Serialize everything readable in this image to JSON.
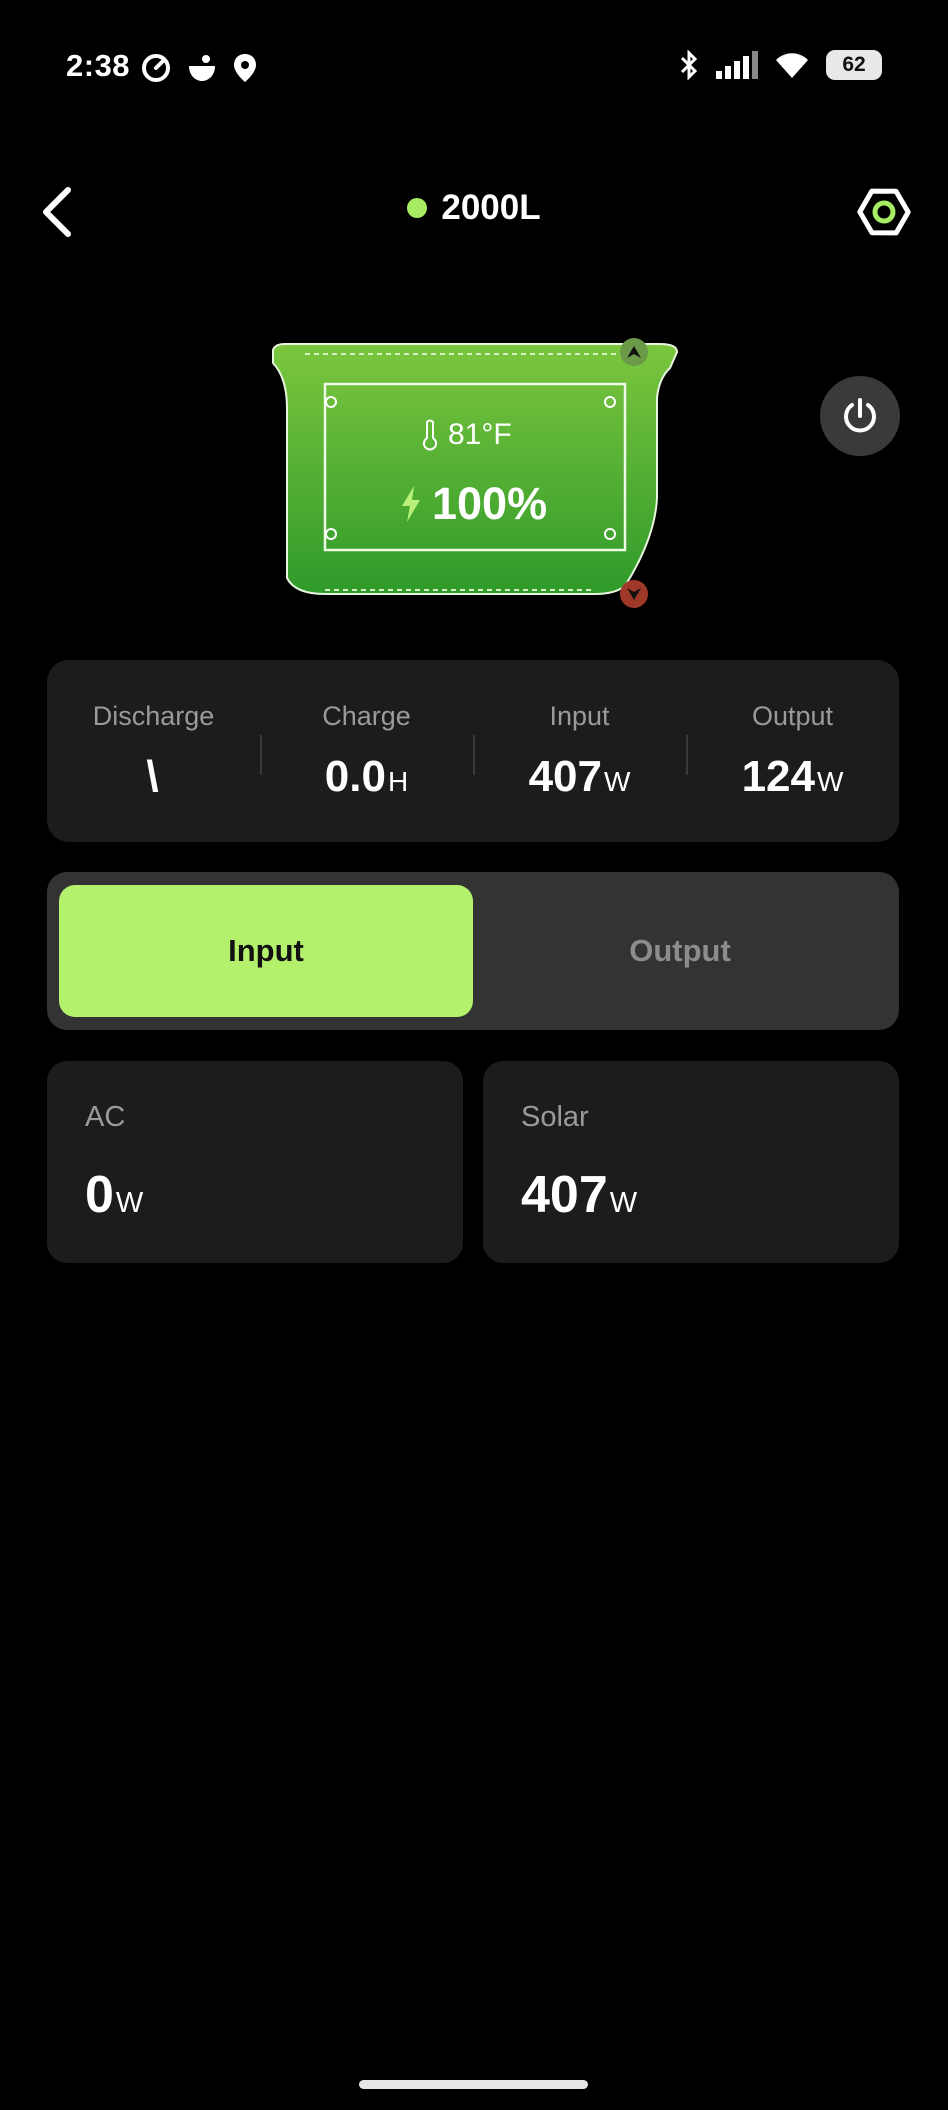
{
  "status_bar": {
    "time": "2:38",
    "battery": "62",
    "icons_left": [
      "sync-icon",
      "bowl-icon",
      "location-icon"
    ],
    "icons_right": [
      "bluetooth-icon",
      "signal-icon",
      "wifi-icon",
      "battery-icon"
    ]
  },
  "header": {
    "title": "2000L",
    "online_color": "#a7ec62"
  },
  "device": {
    "temperature": "81°F",
    "battery_level": "100%"
  },
  "stats": [
    {
      "label": "Discharge",
      "value": "\\",
      "unit": ""
    },
    {
      "label": "Charge",
      "value": "0.0",
      "unit": "H"
    },
    {
      "label": "Input",
      "value": "407",
      "unit": "W"
    },
    {
      "label": "Output",
      "value": "124",
      "unit": "W"
    }
  ],
  "tabs": {
    "active": "Input",
    "inactive": "Output"
  },
  "sources": [
    {
      "label": "AC",
      "value": "0",
      "unit": "W"
    },
    {
      "label": "Solar",
      "value": "407",
      "unit": "W"
    }
  ],
  "colors": {
    "accent": "#b3f06c",
    "device_green": "#4cb232",
    "card": "#1c1c1c"
  }
}
